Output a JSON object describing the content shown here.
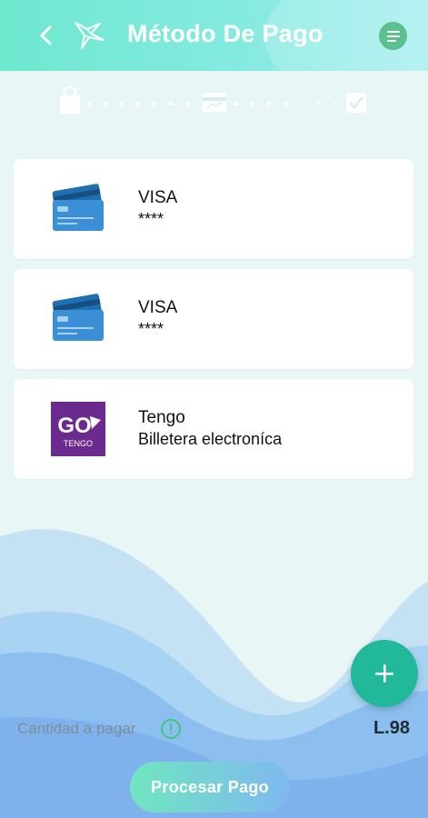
{
  "header": {
    "title": "Método De Pago",
    "icons": {
      "back": "chevron-left-icon",
      "logo": "brand-logo-icon",
      "menu": "menu-lines-icon"
    }
  },
  "stepper": {
    "steps": [
      {
        "icon": "shopping-bag-icon",
        "state": "complete"
      },
      {
        "icon": "credit-card-icon",
        "state": "current"
      },
      {
        "icon": "checkbox-icon",
        "state": "pending"
      }
    ]
  },
  "payment_methods": [
    {
      "name": "VISA",
      "detail": "****",
      "icon": "credit-cards-icon"
    },
    {
      "name": "VISA",
      "detail": "****",
      "icon": "credit-cards-icon"
    },
    {
      "name": "Tengo",
      "detail": "Billetera electroníca",
      "icon": "tengo-logo-icon",
      "logo_text": "GO",
      "logo_subtext": "TENGO"
    }
  ],
  "summary": {
    "amount_label": "Cantidad a pagar",
    "amount": "L.98"
  },
  "actions": {
    "add_icon": "plus-icon",
    "process_label": "Procesar Pago"
  },
  "colors": {
    "accent": "#22b89a",
    "header": "#6ee8cf",
    "background": "#e8f6f6",
    "wave_light": "#b6dcf5",
    "wave_dark": "#8cc0ef"
  }
}
